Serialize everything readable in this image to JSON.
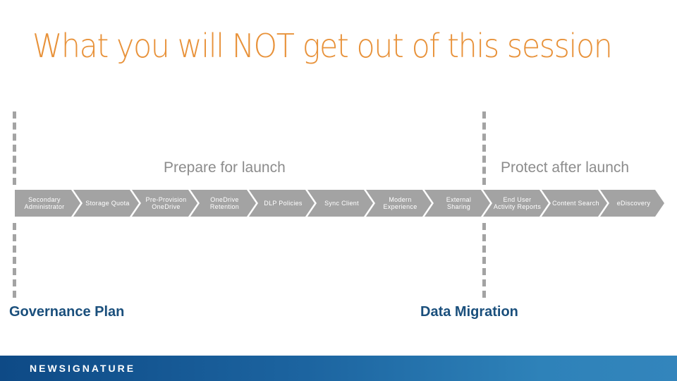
{
  "slide": {
    "title": "What you will NOT get out of this session",
    "phases": {
      "prepare": "Prepare for launch",
      "protect": "Protect after launch"
    },
    "steps": [
      {
        "label": "Secondary Administrator"
      },
      {
        "label": "Storage Quota"
      },
      {
        "label": "Pre-Provision OneDrive"
      },
      {
        "label": "OneDrive Retention"
      },
      {
        "label": "DLP Policies"
      },
      {
        "label": "Sync Client"
      },
      {
        "label": "Modern Experience"
      },
      {
        "label": "External Sharing"
      },
      {
        "label": "End User Activity Reports"
      },
      {
        "label": "Content Search"
      },
      {
        "label": "eDiscovery"
      }
    ],
    "bottom_labels": {
      "left": "Governance Plan",
      "right": "Data Migration"
    },
    "footer": {
      "brand": "NEWSIGNATURE"
    },
    "colors": {
      "title": "#E8923A",
      "chevron": "#A3A3A3",
      "phase_text": "#8C8C8C",
      "bottom_label": "#1A4F7C",
      "footer_start": "#0E4A86",
      "footer_end": "#3385BC"
    }
  }
}
